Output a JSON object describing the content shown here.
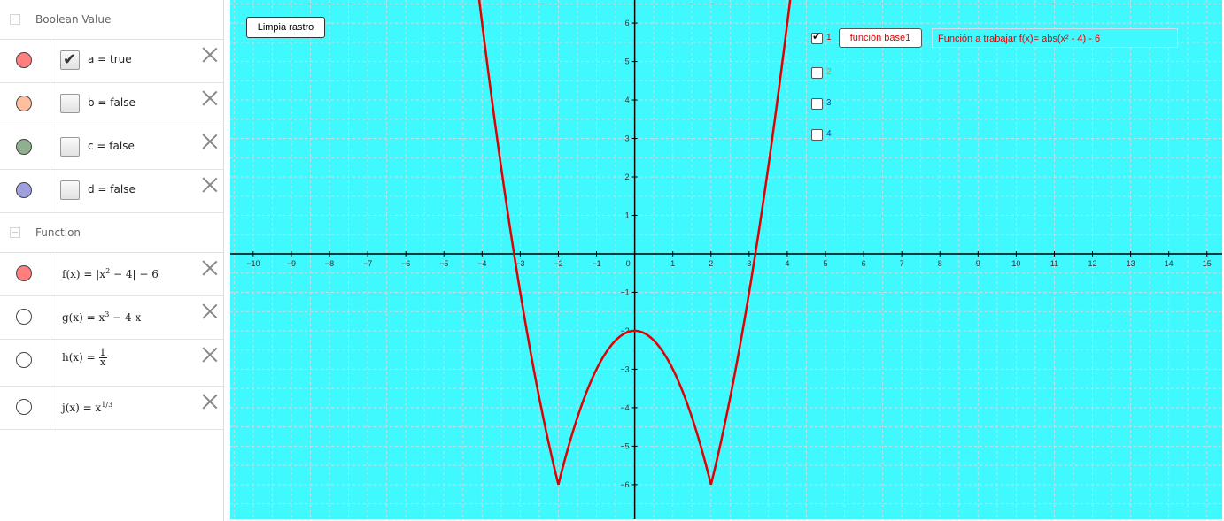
{
  "algebra": {
    "boolean_group": {
      "title": "Boolean Value",
      "items": [
        {
          "label": "a = true",
          "checked": true,
          "color": "#ff7f7f"
        },
        {
          "label": "b = false",
          "checked": false,
          "color": "#ffbf9f"
        },
        {
          "label": "c = false",
          "checked": false,
          "color": "#8faf8f"
        },
        {
          "label": "d = false",
          "checked": false,
          "color": "#9f9fdf"
        }
      ]
    },
    "function_group": {
      "title": "Function",
      "items": [
        {
          "name": "f",
          "label_prefix": "f(x) = |x",
          "exp": "2",
          "label_suffix": " − 4| − 6",
          "color": "#ff7f7f"
        },
        {
          "name": "g",
          "label_prefix": "g(x) = x",
          "exp": "3",
          "label_suffix": " − 4 x",
          "color": "#ffffff"
        },
        {
          "name": "h",
          "label_prefix": "h(x) = ",
          "num": "1",
          "den": "x",
          "color": "#ffffff"
        },
        {
          "name": "j",
          "label_prefix": "j(x) = x",
          "exp": "1/3",
          "label_suffix": "",
          "color": "#ffffff"
        }
      ]
    }
  },
  "graphics": {
    "background": "#3ff9ff",
    "clear_trace_label": "Limpia rastro",
    "checkboxes": [
      {
        "label": "1",
        "checked": true,
        "color": "#e00000"
      },
      {
        "label": "2",
        "checked": false,
        "color": "#e08040"
      },
      {
        "label": "3",
        "checked": false,
        "color": "#0050a0"
      },
      {
        "label": "4",
        "checked": false,
        "color": "#0050a0"
      }
    ],
    "base_function_label": "función base1",
    "function_text": "Función a trabajar f(x)= abs(x² - 4) - 6",
    "curve_color": "#e00000",
    "x_ticks": [
      "−10",
      "−9",
      "−8",
      "−7",
      "−6",
      "−5",
      "−4",
      "−3",
      "−2",
      "−1",
      "0",
      "1",
      "2",
      "3",
      "4",
      "5",
      "6",
      "7",
      "8",
      "9",
      "10",
      "11",
      "12",
      "13",
      "14",
      "15"
    ],
    "y_ticks": [
      "6",
      "5",
      "4",
      "3",
      "2",
      "1",
      "−1",
      "−2",
      "−3",
      "−4",
      "−5",
      "−6"
    ]
  },
  "chart_data": {
    "type": "line",
    "title": "",
    "xlim": [
      -10.6,
      15.4
    ],
    "ylim": [
      -6.9,
      6.6
    ],
    "grid": true,
    "series": [
      {
        "name": "f",
        "expression": "abs(x^2 - 4) - 6",
        "x": [
          -3.9,
          -3.5,
          -3,
          -2.5,
          -2,
          -1.5,
          -1,
          -0.5,
          0,
          0.5,
          1,
          1.5,
          2,
          2.5,
          3,
          3.5,
          3.9
        ],
        "y": [
          7.21,
          2.25,
          -1,
          -3.75,
          -6,
          -4.25,
          -3,
          -2.25,
          -2,
          -2.25,
          -3,
          -4.25,
          -6,
          -3.75,
          -1,
          2.25,
          7.21
        ]
      }
    ]
  }
}
